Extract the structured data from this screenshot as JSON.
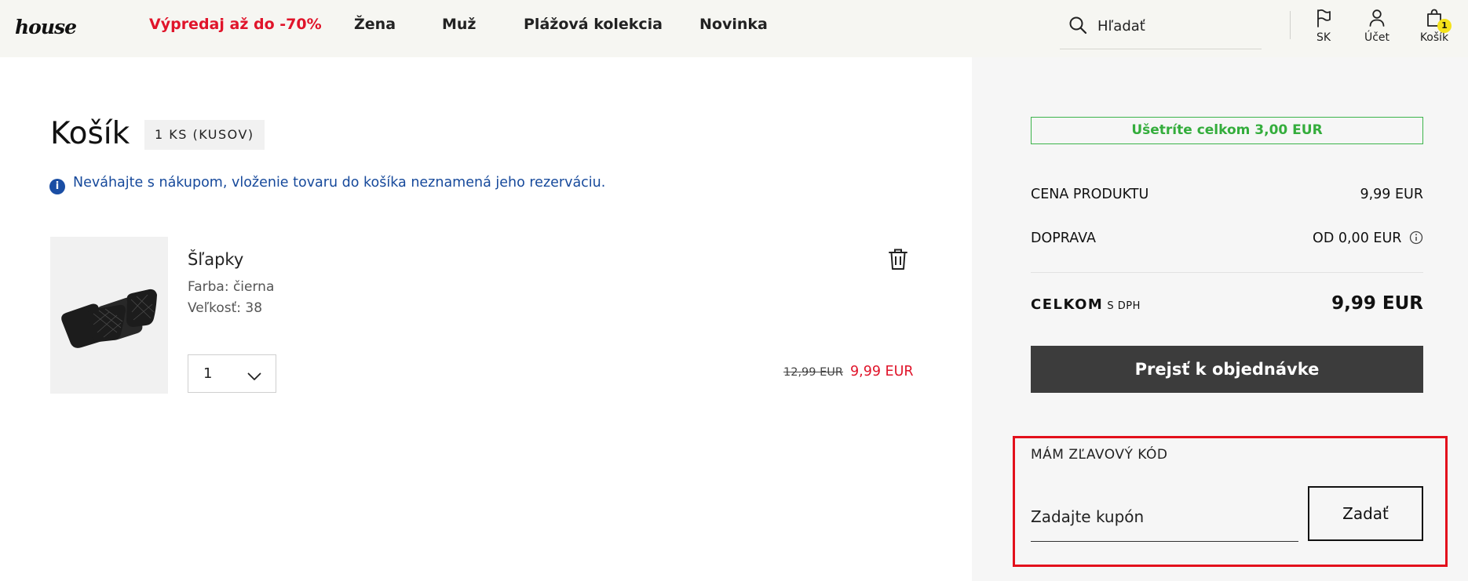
{
  "header": {
    "logo": "house",
    "nav": [
      "Výpredaj až do -70%",
      "Žena",
      "Muž",
      "Plážová kolekcia",
      "Novinka"
    ],
    "search_placeholder": "Hľadať",
    "country": "SK",
    "account": "Účet",
    "cart": "Košík",
    "cart_count": "1"
  },
  "cart": {
    "title": "Košík",
    "count_badge": "1 KS (KUSOV)",
    "info_icon": "info-icon",
    "info": "Neváhajte s nákupom, vloženie tovaru do košíka neznamená jeho rezerváciu.",
    "item": {
      "name": "Šľapky",
      "color": "Farba: čierna",
      "size": "Veľkosť: 38",
      "quantity": "1",
      "price_old": "12,99 EUR",
      "price_new": "9,99 EUR"
    }
  },
  "summary": {
    "savings": "Ušetríte celkom 3,00 EUR",
    "product_price_label": "CENA PRODUKTU",
    "product_price_value": "9,99 EUR",
    "shipping_label": "DOPRAVA",
    "shipping_value": "OD 0,00 EUR",
    "total_label": "CELKOM",
    "total_vat": "S DPH",
    "total_value": "9,99 EUR",
    "checkout": "Prejsť k objednávke",
    "coupon_label": "MÁM ZĽAVOVÝ KÓD",
    "coupon_placeholder": "Zadajte kupón",
    "coupon_submit": "Zadať"
  },
  "colors": {
    "sale_red": "#e0142a",
    "savings_green": "#34ad3c",
    "info_blue": "#16499b",
    "checkout_bg": "#3c3c3c",
    "highlight_red": "#e3101c"
  }
}
